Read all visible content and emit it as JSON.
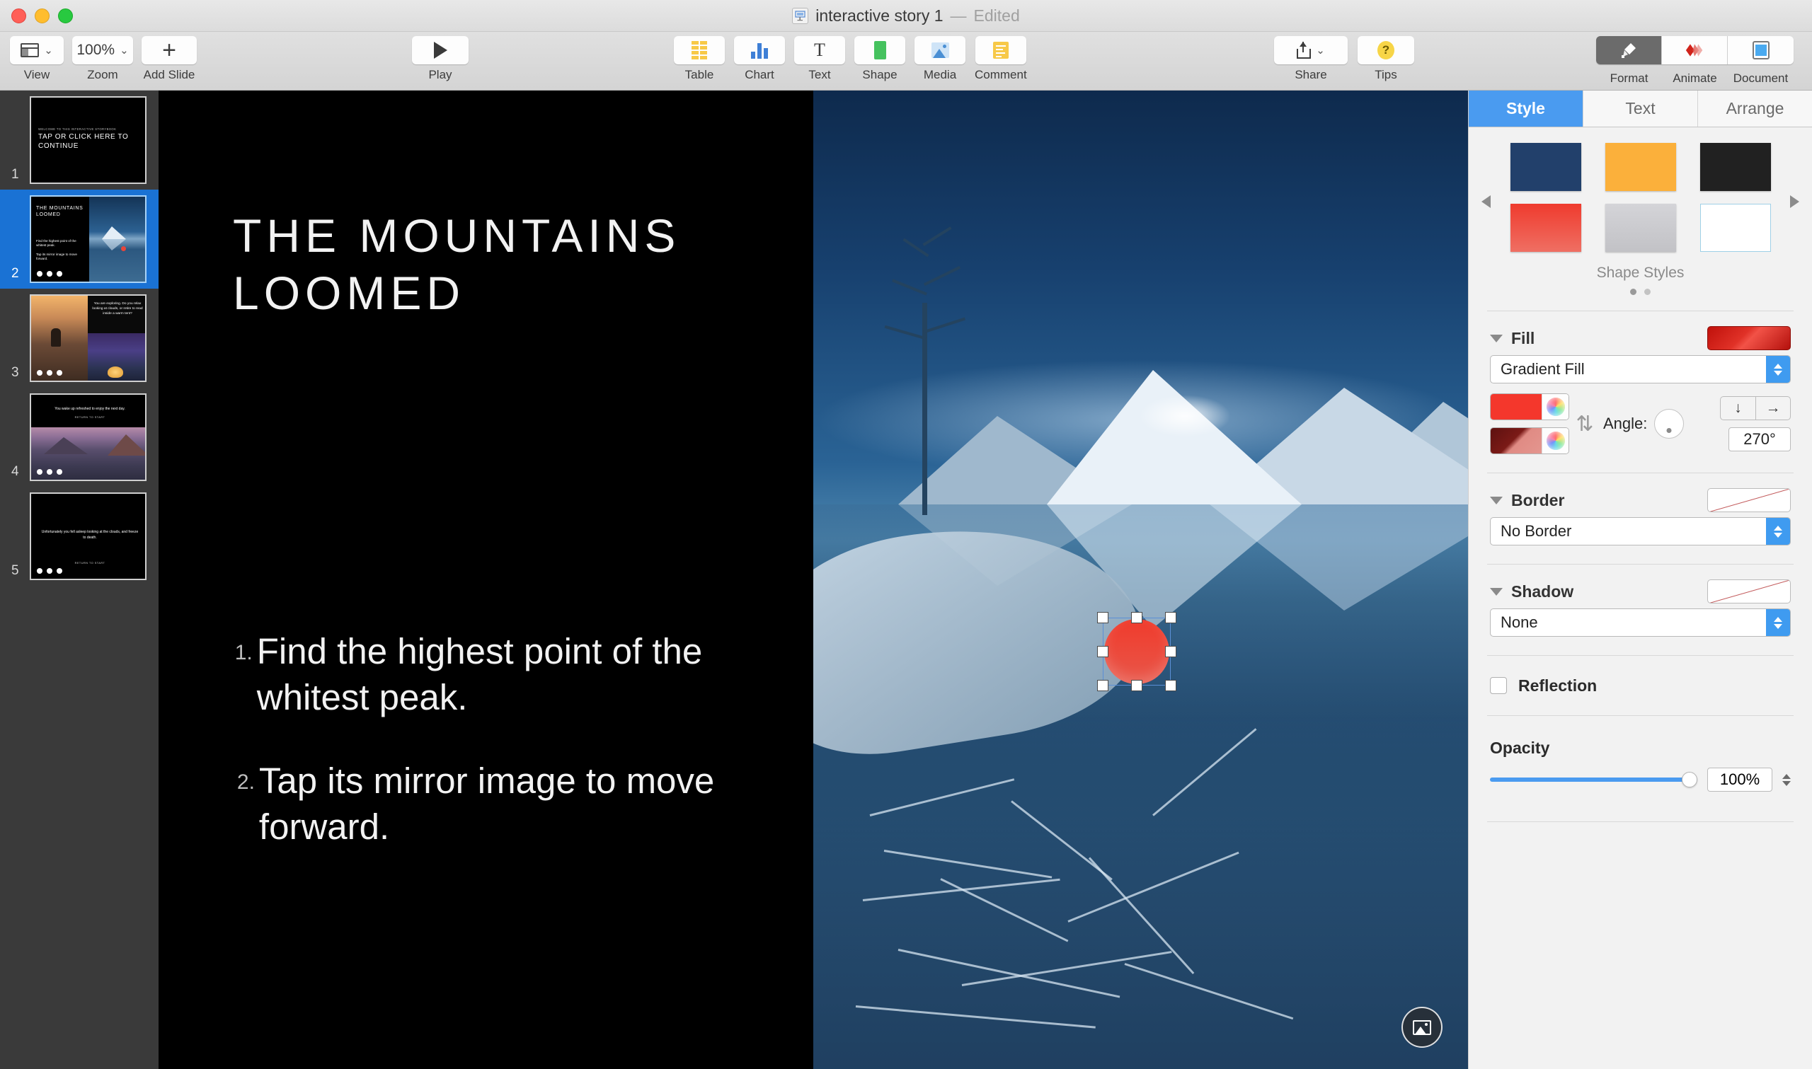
{
  "window": {
    "title": "interactive story 1",
    "separator": "—",
    "edited_status": "Edited",
    "app_icon": "keynote-icon"
  },
  "toolbar": {
    "left_items": [
      {
        "label": "View",
        "icon": "view-layout-icon",
        "has_chevron": true
      },
      {
        "label": "Zoom",
        "icon": "zoom-level",
        "value": "100%",
        "has_chevron": true
      },
      {
        "label": "Add Slide",
        "icon": "plus-icon",
        "has_chevron": false
      }
    ],
    "play": {
      "label": "Play",
      "icon": "play-triangle-icon"
    },
    "insert_items": [
      {
        "label": "Table",
        "icon": "table-icon"
      },
      {
        "label": "Chart",
        "icon": "chart-bar-icon"
      },
      {
        "label": "Text",
        "icon": "text-t-icon"
      },
      {
        "label": "Shape",
        "icon": "shape-square-icon"
      },
      {
        "label": "Media",
        "icon": "media-photo-icon"
      },
      {
        "label": "Comment",
        "icon": "comment-note-icon"
      }
    ],
    "right_items": [
      {
        "label": "Share",
        "icon": "share-upload-icon",
        "has_chevron": true
      },
      {
        "label": "Tips",
        "icon": "tips-question-icon",
        "has_chevron": false
      }
    ],
    "inspector_toggles": [
      {
        "label": "Format",
        "icon": "format-brush-icon",
        "active": true
      },
      {
        "label": "Animate",
        "icon": "animate-diamond-icon",
        "active": false
      },
      {
        "label": "Document",
        "icon": "document-icon",
        "active": false
      }
    ]
  },
  "navigator": {
    "slides": [
      {
        "number": "1",
        "selected": false,
        "eyebrow": "WELCOME TO THIS INTERACTIVE STORYBOOK",
        "heading": "TAP OR CLICK HERE TO CONTINUE",
        "has_dots": false
      },
      {
        "number": "2",
        "selected": true,
        "heading": "THE MOUNTAINS LOOMED",
        "body_1": "Find the highest point of the whitest peak.",
        "body_2": "Tap its mirror image to move forward.",
        "has_dots": true
      },
      {
        "number": "3",
        "selected": false,
        "body_1": "You are exploring. Do you relax looking at clouds, or retire to read inside a warm tent?",
        "has_dots": true
      },
      {
        "number": "4",
        "selected": false,
        "body_1": "You wake up refreshed to enjoy the next day.",
        "footer": "RETURN TO START",
        "has_dots": true
      },
      {
        "number": "5",
        "selected": false,
        "body_1": "Unfortunately you fell asleep looking at the clouds, and freeze to death.",
        "footer": "RETURN TO START",
        "has_dots": true
      }
    ]
  },
  "slide": {
    "title": "THE MOUNTAINS LOOMED",
    "bullets": [
      {
        "number": "1.",
        "text": "Find the highest point of the whitest peak."
      },
      {
        "number": "2.",
        "text": "Tap its mirror image to move forward."
      }
    ],
    "selected_object": "red-circle-shape",
    "media_badge_icon": "image-placeholder-icon"
  },
  "inspector": {
    "tabs": [
      {
        "label": "Style",
        "active": true
      },
      {
        "label": "Text",
        "active": false
      },
      {
        "label": "Arrange",
        "active": false
      }
    ],
    "shape_styles": {
      "label": "Shape Styles",
      "swatches": [
        {
          "name": "navy",
          "color": "#22406b"
        },
        {
          "name": "amber",
          "color": "#fbb03b"
        },
        {
          "name": "charcoal",
          "color": "#212121"
        },
        {
          "name": "red-gradient",
          "color": "#ef3b2e"
        },
        {
          "name": "light-gray",
          "color": "#c9c9cc"
        },
        {
          "name": "white-outline",
          "color": "#ffffff"
        }
      ],
      "page_dots": 2,
      "current_page": 1
    },
    "fill": {
      "title": "Fill",
      "type": "Gradient Fill",
      "start_color": "#f4372c",
      "end_color": "#6e1210",
      "angle_label": "Angle:",
      "angle_value": "270°",
      "direction_buttons": [
        "down-arrow",
        "right-arrow"
      ],
      "swap_icon": "swap-colors-icon"
    },
    "border": {
      "title": "Border",
      "type": "No Border"
    },
    "shadow": {
      "title": "Shadow",
      "type": "None"
    },
    "reflection": {
      "label": "Reflection",
      "checked": false
    },
    "opacity": {
      "label": "Opacity",
      "value": "100%",
      "percent": 100
    }
  }
}
